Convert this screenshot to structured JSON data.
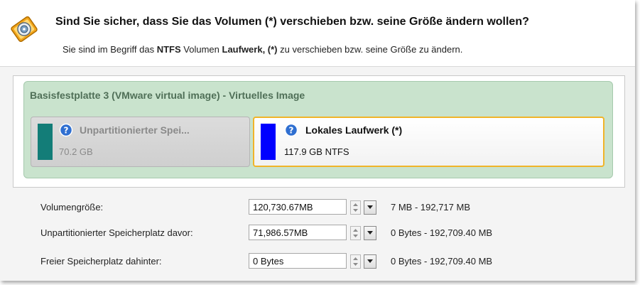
{
  "header": {
    "title": "Sind Sie sicher, dass Sie das Volumen (*) verschieben bzw. seine Größe ändern wollen?",
    "subtitle_pre": "Sie sind im Begriff das ",
    "subtitle_fs": "NTFS",
    "subtitle_mid": " Volumen ",
    "subtitle_volume": "Laufwerk, (*)",
    "subtitle_post": " zu verschieben bzw. seine Größe zu ändern.",
    "icon": "disk-resize-icon"
  },
  "disk": {
    "title": "Basisfestplatte 3 (VMware virtual image) - Virtuelles Image",
    "panel_color": "#c9e3cd",
    "partitions": [
      {
        "name": "Unpartitionierter Spei...",
        "info": "70.2 GB",
        "color": "#137d78",
        "icon": "help-icon",
        "selected": false
      },
      {
        "name": "Lokales Laufwerk (*)",
        "info": "117.9 GB NTFS",
        "color": "#0000ff",
        "icon": "help-icon",
        "selected": true,
        "selection_color": "#f0b429"
      }
    ]
  },
  "fields": [
    {
      "label": "Volumengröße:",
      "value": "120,730.67MB",
      "range": "7 MB - 192,717 MB"
    },
    {
      "label": "Unpartitionierter Speicherplatz davor:",
      "value": "71,986.57MB",
      "range": "0 Bytes - 192,709.40 MB"
    },
    {
      "label": "Freier Speicherplatz dahinter:",
      "value": "0 Bytes",
      "range": "0 Bytes - 192,709.40 MB"
    }
  ]
}
